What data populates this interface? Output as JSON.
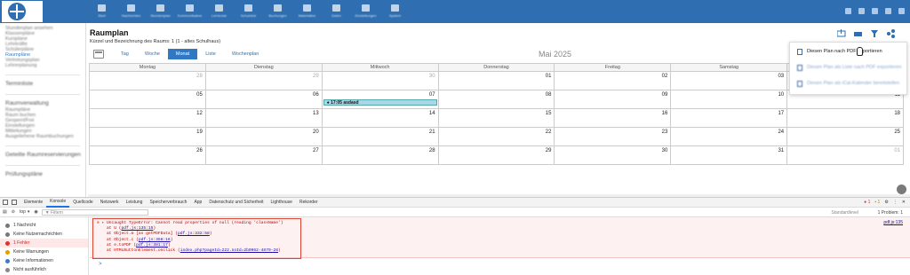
{
  "topbar": {
    "nav_items": [
      "Start",
      "Nachrichten",
      "Stundenplan",
      "Kommunikation",
      "Lernende",
      "Schulnetz",
      "Buchungen",
      "Materialien",
      "Daten",
      "Einstellungen",
      "System"
    ]
  },
  "sidebar": {
    "group1": [
      "Stundenplan ansehen",
      "Klassenpläne",
      "Kursplane",
      "Lehrkräfte",
      "Schülerpläne",
      "Raumpläne",
      "Vertretungsplan",
      "Lehrerplanung"
    ],
    "active_index": 5,
    "group2": [
      "Terminliste"
    ],
    "group3_head": "Raumverwaltung",
    "group3": [
      "Raumpläne",
      "Raum buchen",
      "Gesperrt/Frei",
      "Einstellungen",
      "Mitteilungen",
      "Ausgeliehene Raumbuchungen"
    ],
    "group4": [
      "Geteilte Raumreservierungen"
    ],
    "group5": [
      "Prüfungspläne"
    ]
  },
  "main": {
    "title": "Raumplan",
    "subtitle": "Kürzel und Bezeichnung des Raums: 1 (1 - altes Schulhaus)",
    "views": [
      "Tag",
      "Woche",
      "Monat",
      "Liste",
      "Wochenplan"
    ],
    "active_view": "Monat",
    "month_label": "Mai 2025"
  },
  "calendar": {
    "weekdays": [
      "Montag",
      "Dienstag",
      "Mittwoch",
      "Donnerstag",
      "Freitag",
      "Samstag",
      "Sonntag"
    ],
    "weeks": [
      [
        "28",
        "29",
        "30",
        "01",
        "02",
        "03",
        "04"
      ],
      [
        "05",
        "06",
        "07",
        "08",
        "09",
        "10",
        "11"
      ],
      [
        "12",
        "13",
        "14",
        "15",
        "16",
        "17",
        "18"
      ],
      [
        "19",
        "20",
        "21",
        "22",
        "23",
        "24",
        "25"
      ],
      [
        "26",
        "27",
        "28",
        "29",
        "30",
        "31",
        "01"
      ]
    ],
    "event": {
      "time": "17:05",
      "title": "asdasd"
    }
  },
  "dropdown": {
    "export_pdf": "Diesen Plan nach PDF exportieren",
    "item2": "Diesen Plan als Liste nach PDF exportieren",
    "item3": "Diesen Plan als iCal-Kalender bereitstellen"
  },
  "devtools": {
    "tabs": [
      "Elemente",
      "Konsole",
      "Quellcode",
      "Netzwerk",
      "Leistung",
      "Speicherverbrauch",
      "App",
      "Datenschutz und Sicherheit",
      "Lighthouse",
      "Rekorder"
    ],
    "active_tab": "Konsole",
    "error_count": "1",
    "warn_count": "1",
    "context": "top",
    "filter_placeholder": "Filtern",
    "levels": "Standardlevel",
    "problems": "1 Problem: 1",
    "side_items": [
      "1 Nachricht",
      "Keine Nutzernachrichten",
      "1 Fehler",
      "Keine Warnungen",
      "Keine Informationen",
      "Nicht ausführlich"
    ],
    "error_message": "Uncaught TypeError: Cannot read properties of null (reading 'className')",
    "stack": [
      {
        "pre": "at U (",
        "link": "pdf.js:135:15",
        "post": ")"
      },
      {
        "pre": "at Object.m [as getPDFData] (",
        "link": "pdf.js:332:58",
        "post": ")"
      },
      {
        "pre": "at Object.c (",
        "link": "pdf.js:356:16",
        "post": ")"
      },
      {
        "pre": "at e.toPDF (",
        "link": "pdf.js:381:17",
        "post": ")"
      },
      {
        "pre": "at HTMLButtonElement.onclick (",
        "link": "index.php?pageId=222.noId=2b0962-4879-28",
        "post": ")"
      }
    ],
    "error_source": "pdf.js:135",
    "prompt": ">"
  }
}
